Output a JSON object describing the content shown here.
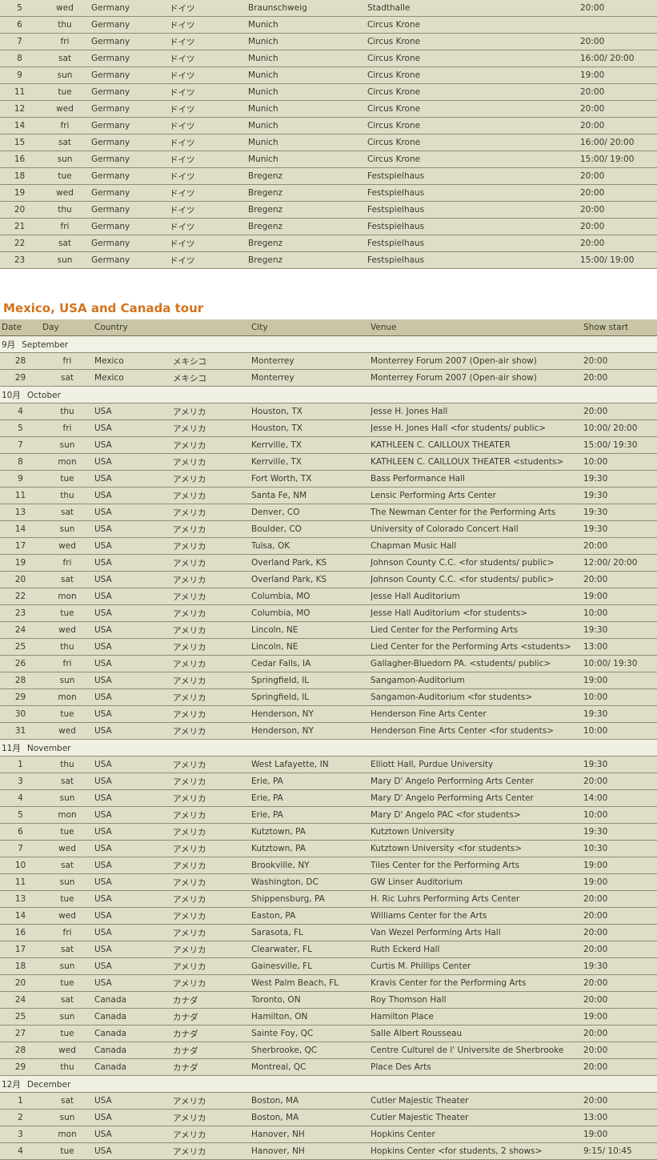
{
  "europe_rows": [
    {
      "date": "5",
      "day": "wed",
      "country": "Germany",
      "country_jp": "ドイツ",
      "city": "Braunschweig",
      "venue": "Stadthalle",
      "show": "20:00"
    },
    {
      "date": "6",
      "day": "thu",
      "country": "Germany",
      "country_jp": "ドイツ",
      "city": "Munich",
      "venue": "Circus Krone",
      "show": ""
    },
    {
      "date": "7",
      "day": "fri",
      "country": "Germany",
      "country_jp": "ドイツ",
      "city": "Munich",
      "venue": "Circus Krone",
      "show": "20:00"
    },
    {
      "date": "8",
      "day": "sat",
      "country": "Germany",
      "country_jp": "ドイツ",
      "city": "Munich",
      "venue": "Circus Krone",
      "show": "16:00/ 20:00"
    },
    {
      "date": "9",
      "day": "sun",
      "country": "Germany",
      "country_jp": "ドイツ",
      "city": "Munich",
      "venue": "Circus Krone",
      "show": "19:00"
    },
    {
      "date": "11",
      "day": "tue",
      "country": "Germany",
      "country_jp": "ドイツ",
      "city": "Munich",
      "venue": "Circus Krone",
      "show": "20:00"
    },
    {
      "date": "12",
      "day": "wed",
      "country": "Germany",
      "country_jp": "ドイツ",
      "city": "Munich",
      "venue": "Circus Krone",
      "show": "20:00"
    },
    {
      "date": "14",
      "day": "fri",
      "country": "Germany",
      "country_jp": "ドイツ",
      "city": "Munich",
      "venue": "Circus Krone",
      "show": "20:00"
    },
    {
      "date": "15",
      "day": "sat",
      "country": "Germany",
      "country_jp": "ドイツ",
      "city": "Munich",
      "venue": "Circus Krone",
      "show": "16:00/ 20:00"
    },
    {
      "date": "16",
      "day": "sun",
      "country": "Germany",
      "country_jp": "ドイツ",
      "city": "Munich",
      "venue": "Circus Krone",
      "show": "15:00/ 19:00"
    },
    {
      "date": "18",
      "day": "tue",
      "country": "Germany",
      "country_jp": "ドイツ",
      "city": "Bregenz",
      "venue": "Festspielhaus",
      "show": "20:00"
    },
    {
      "date": "19",
      "day": "wed",
      "country": "Germany",
      "country_jp": "ドイツ",
      "city": "Bregenz",
      "venue": "Festspielhaus",
      "show": "20:00"
    },
    {
      "date": "20",
      "day": "thu",
      "country": "Germany",
      "country_jp": "ドイツ",
      "city": "Bregenz",
      "venue": "Festspielhaus",
      "show": "20:00"
    },
    {
      "date": "21",
      "day": "fri",
      "country": "Germany",
      "country_jp": "ドイツ",
      "city": "Bregenz",
      "venue": "Festspielhaus",
      "show": "20:00"
    },
    {
      "date": "22",
      "day": "sat",
      "country": "Germany",
      "country_jp": "ドイツ",
      "city": "Bregenz",
      "venue": "Festspielhaus",
      "show": "20:00"
    },
    {
      "date": "23",
      "day": "sun",
      "country": "Germany",
      "country_jp": "ドイツ",
      "city": "Bregenz",
      "venue": "Festspielhaus",
      "show": "15:00/ 19:00"
    }
  ],
  "tour": {
    "title": "Mexico, USA and Canada tour",
    "headers": {
      "date": "Date",
      "day": "Day",
      "country": "Country",
      "city": "City",
      "venue": "Venue",
      "show": "Show start"
    },
    "months": [
      {
        "jp": "9月",
        "en": "September",
        "rows": [
          {
            "date": "28",
            "day": "fri",
            "country": "Mexico",
            "country_jp": "メキシコ",
            "city": "Monterrey",
            "venue": "Monterrey Forum 2007 (Open-air show)",
            "show": "20:00"
          },
          {
            "date": "29",
            "day": "sat",
            "country": "Mexico",
            "country_jp": "メキシコ",
            "city": "Monterrey",
            "venue": "Monterrey Forum 2007 (Open-air show)",
            "show": "20:00"
          }
        ]
      },
      {
        "jp": "10月",
        "en": "October",
        "rows": [
          {
            "date": "4",
            "day": "thu",
            "country": "USA",
            "country_jp": "アメリカ",
            "city": "Houston, TX",
            "venue": "Jesse H. Jones Hall",
            "show": "20:00"
          },
          {
            "date": "5",
            "day": "fri",
            "country": "USA",
            "country_jp": "アメリカ",
            "city": "Houston, TX",
            "venue": "Jesse H. Jones Hall <for students/ public>",
            "show": "10:00/ 20:00"
          },
          {
            "date": "7",
            "day": "sun",
            "country": "USA",
            "country_jp": "アメリカ",
            "city": "Kerrville, TX",
            "venue": "KATHLEEN C. CAILLOUX THEATER",
            "show": "15:00/ 19:30"
          },
          {
            "date": "8",
            "day": "mon",
            "country": "USA",
            "country_jp": "アメリカ",
            "city": "Kerrville, TX",
            "venue": "KATHLEEN C. CAILLOUX THEATER <students>",
            "show": "10:00"
          },
          {
            "date": "9",
            "day": "tue",
            "country": "USA",
            "country_jp": "アメリカ",
            "city": "Fort Worth, TX",
            "venue": "Bass Performance Hall",
            "show": "19:30"
          },
          {
            "date": "11",
            "day": "thu",
            "country": "USA",
            "country_jp": "アメリカ",
            "city": "Santa Fe, NM",
            "venue": "Lensic Performing Arts Center",
            "show": "19:30"
          },
          {
            "date": "13",
            "day": "sat",
            "country": "USA",
            "country_jp": "アメリカ",
            "city": "Denver, CO",
            "venue": "The Newman Center for the Performing Arts",
            "show": "19:30"
          },
          {
            "date": "14",
            "day": "sun",
            "country": "USA",
            "country_jp": "アメリカ",
            "city": "Boulder, CO",
            "venue": "University of Colorado Concert Hall",
            "show": "19:30"
          },
          {
            "date": "17",
            "day": "wed",
            "country": "USA",
            "country_jp": "アメリカ",
            "city": "Tulsa, OK",
            "venue": "Chapman Music Hall",
            "show": "20:00"
          },
          {
            "date": "19",
            "day": "fri",
            "country": "USA",
            "country_jp": "アメリカ",
            "city": "Overland Park, KS",
            "venue": "Johnson County C.C. <for students/ public>",
            "show": "12:00/ 20:00"
          },
          {
            "date": "20",
            "day": "sat",
            "country": "USA",
            "country_jp": "アメリカ",
            "city": "Overland Park, KS",
            "venue": "Johnson County C.C. <for students/ public>",
            "show": "20:00"
          },
          {
            "date": "22",
            "day": "mon",
            "country": "USA",
            "country_jp": "アメリカ",
            "city": "Columbia, MO",
            "venue": "Jesse Hall Auditorium",
            "show": "19:00"
          },
          {
            "date": "23",
            "day": "tue",
            "country": "USA",
            "country_jp": "アメリカ",
            "city": "Columbia, MO",
            "venue": "Jesse Hall Auditorium <for students>",
            "show": "10:00"
          },
          {
            "date": "24",
            "day": "wed",
            "country": "USA",
            "country_jp": "アメリカ",
            "city": "Lincoln, NE",
            "venue": "Lied Center for the Performing Arts",
            "show": "19:30"
          },
          {
            "date": "25",
            "day": "thu",
            "country": "USA",
            "country_jp": "アメリカ",
            "city": "Lincoln, NE",
            "venue": "Lied Center for the Performing Arts <students>",
            "show": "13:00"
          },
          {
            "date": "26",
            "day": "fri",
            "country": "USA",
            "country_jp": "アメリカ",
            "city": "Cedar Falls, IA",
            "venue": "Gallagher-Bluedorn PA. <students/ public>",
            "show": "10:00/ 19:30"
          },
          {
            "date": "28",
            "day": "sun",
            "country": "USA",
            "country_jp": "アメリカ",
            "city": "Springfield, IL",
            "venue": "Sangamon-Auditorium",
            "show": "19:00"
          },
          {
            "date": "29",
            "day": "mon",
            "country": "USA",
            "country_jp": "アメリカ",
            "city": "Springfield, IL",
            "venue": "Sangamon-Auditorium <for students>",
            "show": "10:00"
          },
          {
            "date": "30",
            "day": "tue",
            "country": "USA",
            "country_jp": "アメリカ",
            "city": "Henderson, NY",
            "venue": "Henderson Fine Arts Center",
            "show": "19:30"
          },
          {
            "date": "31",
            "day": "wed",
            "country": "USA",
            "country_jp": "アメリカ",
            "city": "Henderson, NY",
            "venue": "Henderson Fine Arts Center <for students>",
            "show": "10:00"
          }
        ]
      },
      {
        "jp": "11月",
        "en": "November",
        "rows": [
          {
            "date": "1",
            "day": "thu",
            "country": "USA",
            "country_jp": "アメリカ",
            "city": "West Lafayette, IN",
            "venue": "Elliott Hall, Purdue University",
            "show": "19:30"
          },
          {
            "date": "3",
            "day": "sat",
            "country": "USA",
            "country_jp": "アメリカ",
            "city": "Erie, PA",
            "venue": "Mary D' Angelo Performing Arts Center",
            "show": "20:00"
          },
          {
            "date": "4",
            "day": "sun",
            "country": "USA",
            "country_jp": "アメリカ",
            "city": "Erie, PA",
            "venue": "Mary D' Angelo Performing Arts Center",
            "show": "14:00"
          },
          {
            "date": "5",
            "day": "mon",
            "country": "USA",
            "country_jp": "アメリカ",
            "city": "Erie, PA",
            "venue": "Mary D' Angelo PAC <for students>",
            "show": "10:00"
          },
          {
            "date": "6",
            "day": "tue",
            "country": "USA",
            "country_jp": "アメリカ",
            "city": "Kutztown, PA",
            "venue": "Kutztown University",
            "show": "19:30"
          },
          {
            "date": "7",
            "day": "wed",
            "country": "USA",
            "country_jp": "アメリカ",
            "city": "Kutztown, PA",
            "venue": "Kutztown University <for students>",
            "show": "10:30"
          },
          {
            "date": "10",
            "day": "sat",
            "country": "USA",
            "country_jp": "アメリカ",
            "city": "Brookville, NY",
            "venue": "Tiles Center for the Performing Arts",
            "show": "19:00"
          },
          {
            "date": "11",
            "day": "sun",
            "country": "USA",
            "country_jp": "アメリカ",
            "city": "Washington, DC",
            "venue": "GW Linser Auditorium",
            "show": "19:00"
          },
          {
            "date": "13",
            "day": "tue",
            "country": "USA",
            "country_jp": "アメリカ",
            "city": "Shippensburg, PA",
            "venue": "H. Ric Luhrs Performing Arts Center",
            "show": "20:00"
          },
          {
            "date": "14",
            "day": "wed",
            "country": "USA",
            "country_jp": "アメリカ",
            "city": "Easton, PA",
            "venue": "Williams Center for the Arts",
            "show": "20:00"
          },
          {
            "date": "16",
            "day": "fri",
            "country": "USA",
            "country_jp": "アメリカ",
            "city": "Sarasota, FL",
            "venue": "Van Wezel Performing Arts Hall",
            "show": "20:00"
          },
          {
            "date": "17",
            "day": "sat",
            "country": "USA",
            "country_jp": "アメリカ",
            "city": "Clearwater, FL",
            "venue": "Ruth Eckerd Hall",
            "show": "20:00"
          },
          {
            "date": "18",
            "day": "sun",
            "country": "USA",
            "country_jp": "アメリカ",
            "city": "Gainesville, FL",
            "venue": "Curtis M. Phillips Center",
            "show": "19:30"
          },
          {
            "date": "20",
            "day": "tue",
            "country": "USA",
            "country_jp": "アメリカ",
            "city": "West Palm Beach, FL",
            "venue": "Kravis Center for the Performing Arts",
            "show": "20:00"
          },
          {
            "date": "24",
            "day": "sat",
            "country": "Canada",
            "country_jp": "カナダ",
            "city": "Toronto, ON",
            "venue": "Roy Thomson Hall",
            "show": "20:00"
          },
          {
            "date": "25",
            "day": "sun",
            "country": "Canada",
            "country_jp": "カナダ",
            "city": "Hamilton, ON",
            "venue": "Hamilton Place",
            "show": "19:00"
          },
          {
            "date": "27",
            "day": "tue",
            "country": "Canada",
            "country_jp": "カナダ",
            "city": "Sainte Foy, QC",
            "venue": "Salle Albert Rousseau",
            "show": "20:00"
          },
          {
            "date": "28",
            "day": "wed",
            "country": "Canada",
            "country_jp": "カナダ",
            "city": "Sherbrooke, QC",
            "venue": "Centre Culturel de l' Universite de Sherbrooke",
            "show": "20:00"
          },
          {
            "date": "29",
            "day": "thu",
            "country": "Canada",
            "country_jp": "カナダ",
            "city": "Montreal, QC",
            "venue": "Place Des Arts",
            "show": "20:00"
          }
        ]
      },
      {
        "jp": "12月",
        "en": "December",
        "rows": [
          {
            "date": "1",
            "day": "sat",
            "country": "USA",
            "country_jp": "アメリカ",
            "city": "Boston, MA",
            "venue": "Cutler Majestic Theater",
            "show": "20:00"
          },
          {
            "date": "2",
            "day": "sun",
            "country": "USA",
            "country_jp": "アメリカ",
            "city": "Boston, MA",
            "venue": "Cutler Majestic Theater",
            "show": "13:00"
          },
          {
            "date": "3",
            "day": "mon",
            "country": "USA",
            "country_jp": "アメリカ",
            "city": "Hanover, NH",
            "venue": "Hopkins Center",
            "show": "19:00"
          },
          {
            "date": "4",
            "day": "tue",
            "country": "USA",
            "country_jp": "アメリカ",
            "city": "Hanover, NH",
            "venue": "Hopkins Center <for students, 2 shows>",
            "show": "9:15/ 10:45"
          }
        ]
      }
    ]
  }
}
